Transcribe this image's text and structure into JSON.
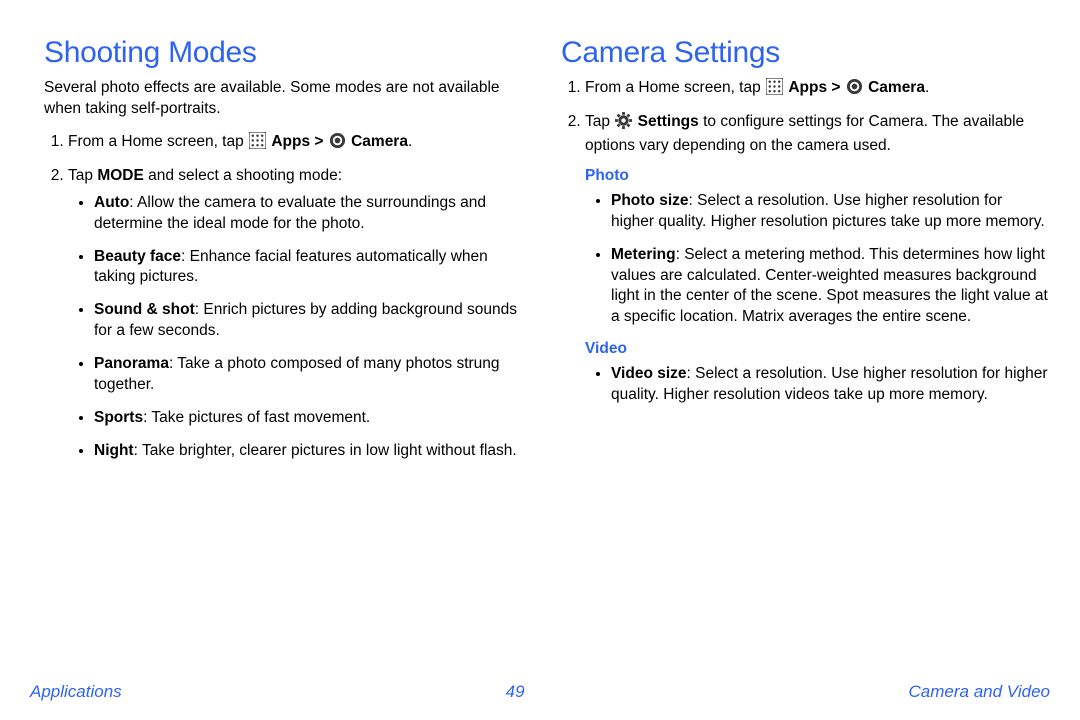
{
  "left": {
    "heading": "Shooting Modes",
    "intro": "Several photo effects are available. Some modes are not available when taking self-portraits.",
    "step1_a": "From a Home screen, tap ",
    "apps_bold": "Apps > ",
    "camera_bold": "Camera",
    "step1_end": ".",
    "step2_a": "Tap ",
    "mode_bold": "MODE",
    "step2_b": " and select a shooting mode:",
    "modes": [
      {
        "name": "Auto",
        "desc": ": Allow the camera to evaluate the surroundings and determine the ideal mode for the photo."
      },
      {
        "name": "Beauty face",
        "desc": ": Enhance facial features automatically when taking pictures."
      },
      {
        "name": "Sound & shot",
        "desc": ": Enrich pictures by adding background sounds for a few seconds."
      },
      {
        "name": "Panorama",
        "desc": ": Take a photo composed of many photos strung together."
      },
      {
        "name": "Sports",
        "desc": ": Take pictures of fast movement."
      },
      {
        "name": "Night",
        "desc": ": Take brighter, clearer pictures in low light without flash."
      }
    ]
  },
  "right": {
    "heading": "Camera Settings",
    "step1_a": "From a Home screen, tap ",
    "apps_bold": "Apps > ",
    "camera_bold": "Camera",
    "step1_end": ".",
    "step2_a": "Tap ",
    "settings_bold": "Settings",
    "step2_b": " to configure settings for Camera. The available options vary depending on the camera used.",
    "photo_label": "Photo",
    "photo_items": [
      {
        "name": "Photo size",
        "desc": ": Select a resolution. Use higher resolution for higher quality. Higher resolution pictures take up more memory."
      },
      {
        "name": "Metering",
        "desc": ": Select a metering method. This determines how light values are calculated. Center-weighted measures background light in the center of the scene. Spot measures the light value at a specific location. Matrix averages the entire scene."
      }
    ],
    "video_label": "Video",
    "video_items": [
      {
        "name": "Video size",
        "desc": ": Select a resolution. Use higher resolution for higher quality. Higher resolution videos take up more memory."
      }
    ]
  },
  "footer": {
    "left": "Applications",
    "page": "49",
    "right": "Camera and Video"
  }
}
